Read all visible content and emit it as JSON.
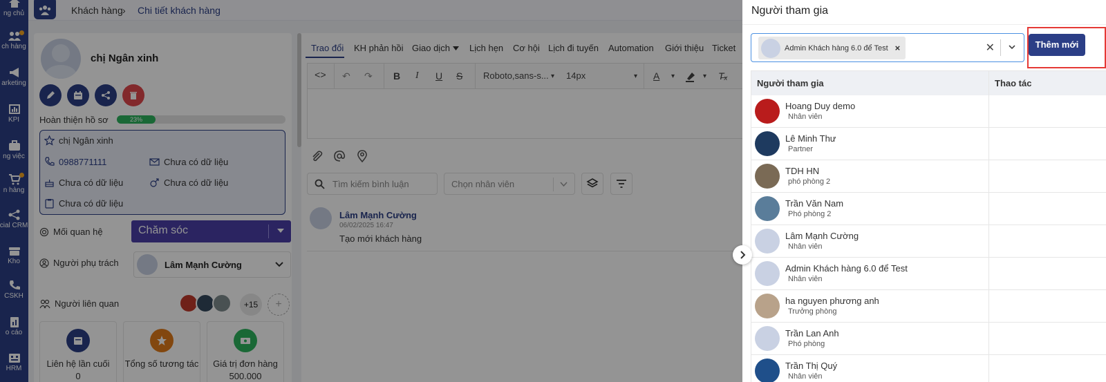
{
  "nav": {
    "items": [
      {
        "label": "ng chủ",
        "icon": "home-icon"
      },
      {
        "label": "ch hàng",
        "icon": "users-icon"
      },
      {
        "label": "arketing",
        "icon": "megaphone-icon"
      },
      {
        "label": "KPI",
        "icon": "chart-icon"
      },
      {
        "label": "ng việc",
        "icon": "briefcase-icon"
      },
      {
        "label": "n hàng",
        "icon": "cart-icon"
      },
      {
        "label": "cial CRM",
        "icon": "share-icon"
      },
      {
        "label": "Kho",
        "icon": "warehouse-icon"
      },
      {
        "label": "CSKH",
        "icon": "phone-icon"
      },
      {
        "label": "o cáo",
        "icon": "report-icon"
      },
      {
        "label": "HRM",
        "icon": "hrm-icon"
      }
    ]
  },
  "breadcrumb": {
    "root": "Khách hàng",
    "separator": "›",
    "current": "Chi tiết khách hàng"
  },
  "customer": {
    "name": "chị Ngân xinh",
    "progress_label": "Hoàn thiện hồ sơ",
    "progress_value": 23,
    "progress_text": "23%",
    "info": {
      "name": "chị Ngân xinh",
      "phone": "0988771111",
      "email": "Chưa có dữ liệu",
      "birthday": "Chưa có dữ liệu",
      "gender": "Chưa có dữ liệu",
      "note": "Chưa có dữ liệu"
    },
    "relationship_label": "Mối quan hệ",
    "relationship_value": "Chăm sóc",
    "owner_label": "Người phụ trách",
    "owner_value": "Lâm Mạnh Cường",
    "related_label": "Người liên quan",
    "related_more": "+15",
    "related_add": "+",
    "stats": [
      {
        "label": "Liên hệ lần cuối",
        "value": "0"
      },
      {
        "label": "Tổng số tương tác",
        "value": ""
      },
      {
        "label": "Giá trị đơn hàng",
        "value": "500.000"
      }
    ]
  },
  "tabs": [
    {
      "label": "Trao đổi"
    },
    {
      "label": "KH phản hồi"
    },
    {
      "label": "Giao dịch"
    },
    {
      "label": "Lịch hẹn"
    },
    {
      "label": "Cơ hội"
    },
    {
      "label": "Lịch đi tuyến"
    },
    {
      "label": "Automation"
    },
    {
      "label": "Giới thiệu"
    },
    {
      "label": "Ticket"
    }
  ],
  "editor": {
    "font_family": "Roboto,sans-s...",
    "font_size": "14px"
  },
  "comments": {
    "search_placeholder": "Tìm kiếm bình luận",
    "employee_placeholder": "Chọn nhân viên",
    "items": [
      {
        "author": "Lâm Mạnh Cường",
        "time": "06/02/2025 16:47",
        "text": "Tạo mới khách hàng"
      }
    ]
  },
  "drawer": {
    "title": "Người tham gia",
    "selected_chip": "Admin Khách hàng 6.0 để Test",
    "add_button": "Thêm mới",
    "col_participant": "Người tham gia",
    "col_action": "Thao tác",
    "participants": [
      {
        "name": "Hoang Duy demo",
        "role": "Nhân viên"
      },
      {
        "name": "Lê Minh Thư",
        "role": "Partner"
      },
      {
        "name": "TDH HN",
        "role": "phó phòng 2"
      },
      {
        "name": "Trần Văn Nam",
        "role": "Phó phòng 2"
      },
      {
        "name": "Lâm Mạnh Cường",
        "role": "Nhân viên"
      },
      {
        "name": "Admin Khách hàng 6.0 để Test",
        "role": "Nhân viên"
      },
      {
        "name": "ha nguyen phương anh",
        "role": "Trưởng phòng"
      },
      {
        "name": "Trần Lan Anh",
        "role": "Phó phòng"
      },
      {
        "name": "Trần Thị Quý",
        "role": "Nhân viên"
      }
    ]
  },
  "colors": {
    "primary": "#2b3e86",
    "relationship": "#4a3fa8",
    "progress": "#2db35d",
    "danger": "#e0474c",
    "highlight": "#e53935"
  }
}
